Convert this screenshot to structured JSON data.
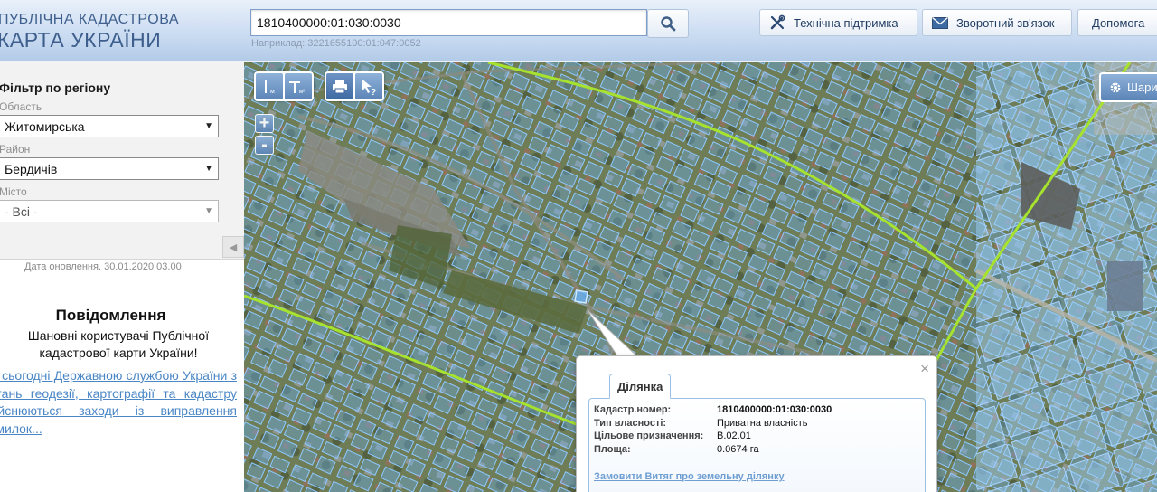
{
  "header": {
    "logo_line1": "ПУБЛІЧНА КАДАСТРОВА",
    "logo_line2": "КАРТА УКРАЇНИ",
    "search": {
      "value": "1810400000:01:030:0030",
      "hint": "Наприклад: 3221655100:01:047:0052"
    },
    "buttons": {
      "support": "Технічна підтримка",
      "feedback": "Зворотний зв'язок",
      "help": "Допомога"
    }
  },
  "filter": {
    "title": "Фільтр по регіону",
    "oblast_label": "Область",
    "oblast_value": "Житомирська",
    "rayon_label": "Район",
    "rayon_value": "Бердичів",
    "misto_label": "Місто",
    "misto_value": "- Всі -"
  },
  "update_date": "Дата оновлення. 30.01.2020 03.00",
  "notice": {
    "title": "Повідомлення",
    "greeting": "Шановні користувачі Публічної кадастрової карти України!",
    "link_text": "На сьогодні Державною службою України з питань геодезії, картографії та кадастру здійснюються заходи із виправлення помилок..."
  },
  "map": {
    "layers_label": "Шари",
    "zoom_in": "+",
    "zoom_out": "-"
  },
  "popup": {
    "tab": "Ділянка",
    "close": "×",
    "rows": {
      "cadnum": {
        "label": "Кадастр.номер:",
        "value": "1810400000:01:030:0030"
      },
      "ownership": {
        "label": "Тип власності:",
        "value": "Приватна власність"
      },
      "purpose": {
        "label": "Цільове призначення:",
        "value": "В.02.01"
      },
      "area": {
        "label": "Площа:",
        "value": "0.0674 га"
      }
    },
    "link": "Замовити Витяг про земельну ділянку"
  },
  "colors": {
    "accent": "#5b84b7",
    "parcel_fill": "#66b3ff",
    "boundary": "#a6e22e",
    "link": "#4a86c5"
  }
}
